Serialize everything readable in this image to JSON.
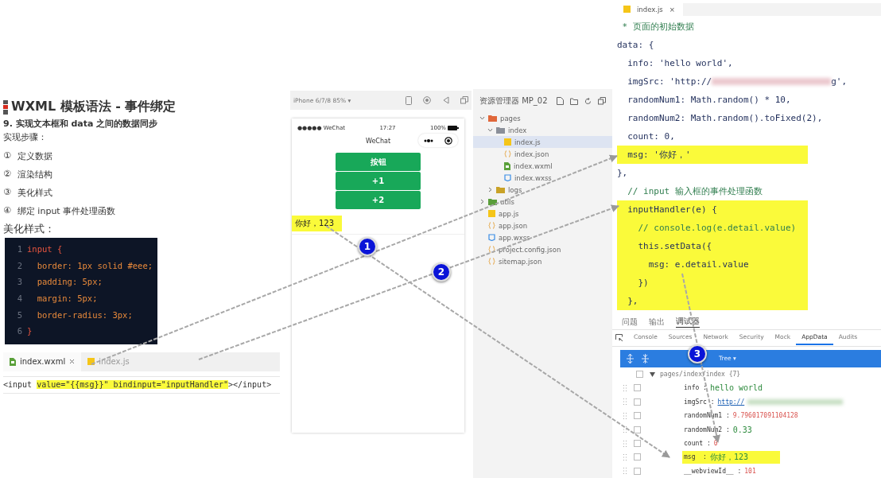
{
  "doc": {
    "title": "WXML 模板语法 - 事件绑定",
    "subtitle": "9. 实现文本框和 data 之间的数据同步",
    "steps_label": "实现步骤：",
    "steps": [
      {
        "marker": "①",
        "text": "定义数据"
      },
      {
        "marker": "②",
        "text": "渲染结构"
      },
      {
        "marker": "③",
        "text": "美化样式"
      },
      {
        "marker": "④",
        "text": "绑定 input 事件处理函数"
      }
    ],
    "style_label": "美化样式：",
    "css_code": [
      {
        "line": "1",
        "code": "input {"
      },
      {
        "line": "2",
        "code": "  border: 1px solid #eee;"
      },
      {
        "line": "3",
        "code": "  padding: 5px;"
      },
      {
        "line": "4",
        "code": "  margin: 5px;"
      },
      {
        "line": "5",
        "code": "  border-radius: 3px;"
      },
      {
        "line": "6",
        "code": "}"
      }
    ]
  },
  "wxml_editor": {
    "tabs": [
      {
        "label": "index.wxml",
        "kind": "wxml",
        "selected": true
      },
      {
        "label": "index.js",
        "kind": "js",
        "selected": false
      }
    ],
    "code": [
      {
        "text": "<input ",
        "highlight": false
      },
      {
        "text": "value=\"{{msg}}\" ",
        "highlight": true
      },
      {
        "text": "bindinput=\"inputHandler\"",
        "highlight": true
      },
      {
        "text": "></input>",
        "highlight": false
      }
    ]
  },
  "simulator": {
    "device": "iPhone 6/7/8 85% ▾",
    "carrier": "●●●●● WeChat",
    "time": "17:27",
    "battery": "100%",
    "nav_title": "WeChat",
    "buttons": [
      "按钮",
      "+1",
      "+2"
    ],
    "input_value": "你好，123",
    "input_highlight": true
  },
  "explorer": {
    "title": "资源管理器 MP_02",
    "tree": [
      {
        "label": "pages",
        "kind": "folder",
        "color": "#e0673a",
        "expanded": true,
        "selected": false,
        "children": [
          {
            "label": "index",
            "kind": "folder",
            "color": "#8a8f99",
            "expanded": true,
            "selected": false,
            "children": [
              {
                "label": "index.js",
                "kind": "js",
                "selected": true
              },
              {
                "label": "index.json",
                "kind": "json",
                "selected": false
              },
              {
                "label": "index.wxml",
                "kind": "wxml",
                "selected": false
              },
              {
                "label": "index.wxss",
                "kind": "wxss",
                "selected": false
              }
            ]
          },
          {
            "label": "logs",
            "kind": "folder",
            "color": "#c9a227",
            "expanded": false,
            "selected": false
          }
        ]
      },
      {
        "label": "utils",
        "kind": "folder",
        "color": "#5a9e3a",
        "expanded": false,
        "selected": false
      },
      {
        "label": "app.js",
        "kind": "js",
        "selected": false
      },
      {
        "label": "app.json",
        "kind": "json",
        "selected": false
      },
      {
        "label": "app.wxss",
        "kind": "wxss",
        "selected": false
      },
      {
        "label": "project.config.json",
        "kind": "json",
        "selected": false
      },
      {
        "label": "sitemap.json",
        "kind": "json",
        "selected": false
      }
    ]
  },
  "js_editor": {
    "tab": "index.js",
    "close": "×",
    "lines": [
      {
        "text": " * 页面的初始数据",
        "kind": "comment",
        "highlight": false
      },
      {
        "text": "data: {",
        "kind": "code",
        "highlight": false
      },
      {
        "text": "  info: 'hello world',",
        "kind": "code",
        "highlight": false
      },
      {
        "text": "  imgSrc: 'http://",
        "kind": "url-redacted",
        "tail": "g',",
        "highlight": false
      },
      {
        "text": "  randomNum1: Math.random() * 10,",
        "kind": "code",
        "highlight": false
      },
      {
        "text": "  randomNum2: Math.random().toFixed(2),",
        "kind": "code",
        "highlight": false
      },
      {
        "text": "  count: 0,",
        "kind": "code",
        "highlight": false
      },
      {
        "text": "  msg: '你好，'",
        "kind": "code",
        "highlight": true
      },
      {
        "text": "},",
        "kind": "code",
        "highlight": false
      },
      {
        "text": "  // input 输入框的事件处理函数",
        "kind": "comment",
        "highlight": false
      },
      {
        "text": "  inputHandler(e) {",
        "kind": "code",
        "highlight": true
      },
      {
        "text": "    // console.log(e.detail.value)",
        "kind": "comment",
        "highlight": true
      },
      {
        "text": "    this.setData({",
        "kind": "code",
        "highlight": true
      },
      {
        "text": "      msg: e.detail.value",
        "kind": "code",
        "highlight": true
      },
      {
        "text": "    })",
        "kind": "code",
        "highlight": true
      },
      {
        "text": "  },",
        "kind": "code",
        "highlight": true
      }
    ]
  },
  "devtools": {
    "panel_tabs": [
      {
        "label": "问题",
        "selected": false
      },
      {
        "label": "输出",
        "selected": false
      },
      {
        "label": "调试器",
        "selected": true
      }
    ],
    "tabs": [
      {
        "label": "Console",
        "selected": false
      },
      {
        "label": "Sources",
        "selected": false
      },
      {
        "label": "Network",
        "selected": false
      },
      {
        "label": "Security",
        "selected": false
      },
      {
        "label": "Mock",
        "selected": false
      },
      {
        "label": "AppData",
        "selected": true
      },
      {
        "label": "Audits",
        "selected": false
      }
    ],
    "view_mode": "Tree ▾",
    "root": {
      "label": "pages/index/index {7}",
      "expanded": true,
      "checked": false
    },
    "entries": [
      {
        "key": "info :",
        "value": "hello world",
        "kind": "string",
        "highlight": false,
        "checked": false
      },
      {
        "key": "imgSrc :",
        "value": "http://",
        "kind": "url",
        "highlight": false,
        "checked": false
      },
      {
        "key": "randomNum1 :",
        "value": "9.796017091104128",
        "kind": "number",
        "highlight": false,
        "checked": false
      },
      {
        "key": "randomNum2 :",
        "value": "0.33",
        "kind": "string",
        "highlight": false,
        "checked": false
      },
      {
        "key": "count :",
        "value": "0",
        "kind": "number",
        "highlight": false,
        "checked": false
      },
      {
        "key": "msg  :",
        "value": "你好，123",
        "kind": "string",
        "highlight": true,
        "checked": false
      },
      {
        "key": "__webviewId__ :",
        "value": "101",
        "kind": "number",
        "highlight": false,
        "checked": false
      }
    ]
  },
  "annotations": [
    {
      "label": "1"
    },
    {
      "label": "2"
    },
    {
      "label": "3"
    }
  ]
}
